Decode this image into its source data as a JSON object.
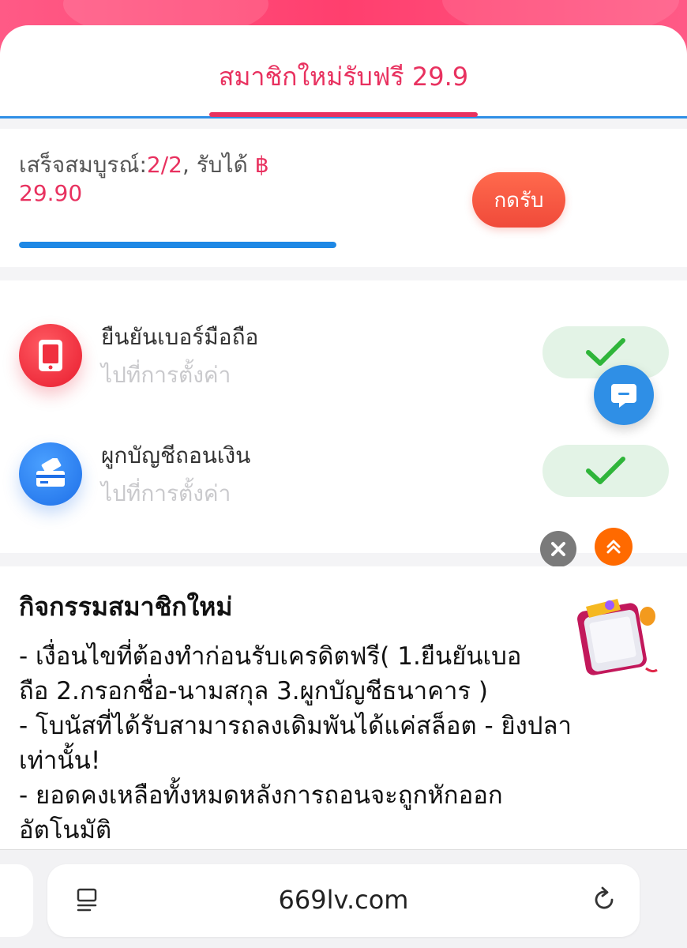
{
  "tab": {
    "title": "สมาชิกใหม่รับฟรี 29.9"
  },
  "progress": {
    "label": "เสร็จสมบูรณ์:",
    "count": "2/2",
    "receive_text": ", รับได้ ",
    "currency": "฿",
    "amount": "29.90",
    "claim_label": "กดรับ",
    "fill_fraction": 1.0
  },
  "tasks": [
    {
      "title": "ยืนยันเบอร์มือถือ",
      "subtitle": "ไปที่การตั้งค่า",
      "icon": "phone-icon",
      "completed": true
    },
    {
      "title": "ผูกบัญชีถอนเงิน",
      "subtitle": "ไปที่การตั้งค่า",
      "icon": "card-icon",
      "completed": true
    }
  ],
  "info": {
    "title": "กิจกรรมสมาชิกใหม่",
    "lines": [
      "- เงื่อนไขที่ต้องทำก่อนรับเครดิตฟรี( 1.ยืนยันเบอ",
      "ถือ  2.กรอกชื่อ-นามสกุล  3.ผูกบัญชีธนาคาร )",
      "- โบนัสที่ได้รับสามารถลงเดิมพันได้แค่สล็อต - ยิงปลา",
      "เท่านั้น!",
      "- ยอดคงเหลือทั้งหมดหลังการถอนจะถูกหักออก",
      "อัตโนมัติ"
    ]
  },
  "browser": {
    "url": "669lv.com"
  },
  "colors": {
    "accent": "#e8315f",
    "blue": "#2f8fe6",
    "success": "#2fb53a"
  }
}
